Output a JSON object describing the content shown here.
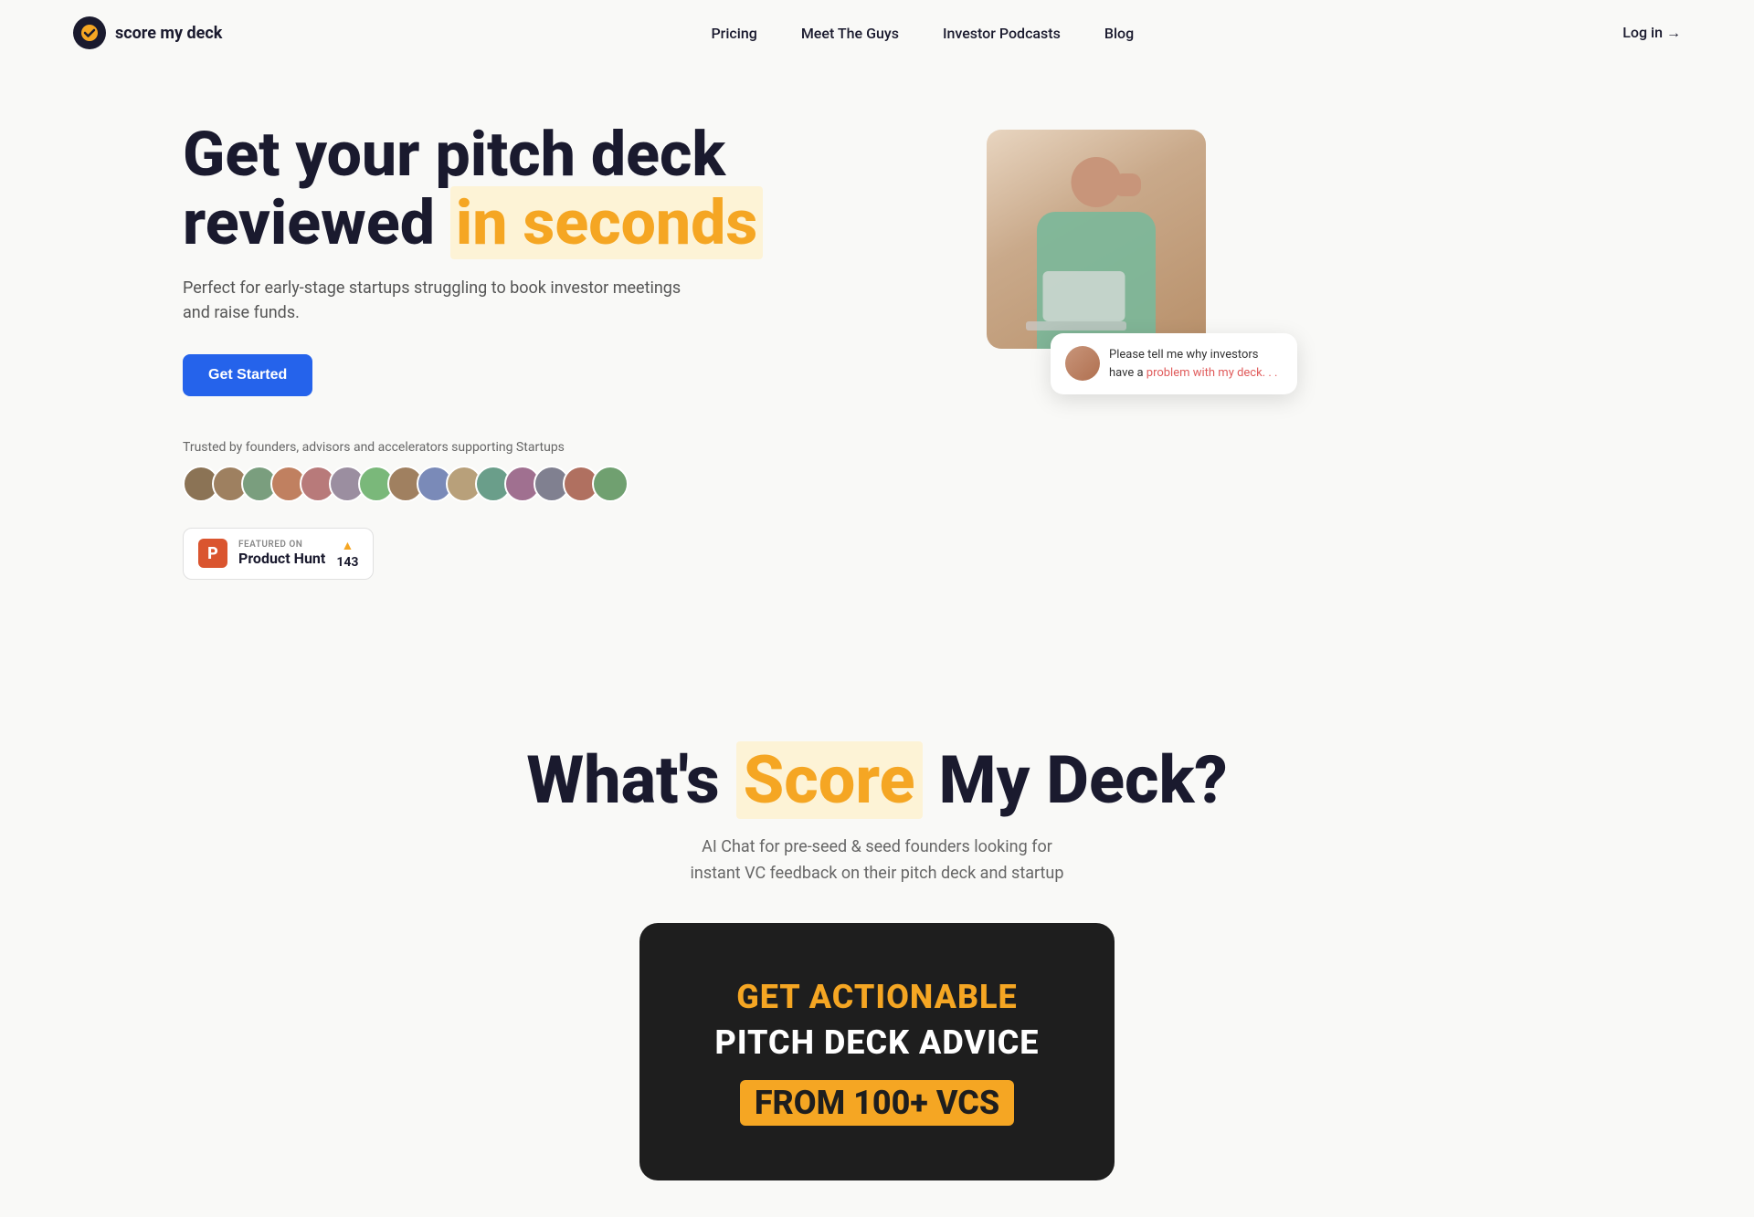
{
  "brand": {
    "name": "score my deck",
    "logo_check": "✓"
  },
  "nav": {
    "links": [
      {
        "label": "Pricing",
        "href": "#"
      },
      {
        "label": "Meet The Guys",
        "href": "#"
      },
      {
        "label": "Investor Podcasts",
        "href": "#"
      },
      {
        "label": "Blog",
        "href": "#"
      }
    ],
    "login_label": "Log in →"
  },
  "hero": {
    "title_line1": "Get your pitch deck",
    "title_line2_plain": "reviewed ",
    "title_line2_highlight": "in seconds",
    "subtitle": "Perfect for early-stage startups struggling to book investor meetings and raise funds.",
    "cta_button": "Get Started",
    "trusted_text": "Trusted by founders, advisors and accelerators supporting Startups",
    "avatars": [
      {
        "id": 1,
        "color": "#8b7355"
      },
      {
        "id": 2,
        "color": "#9e8060"
      },
      {
        "id": 3,
        "color": "#7a9e7e"
      },
      {
        "id": 4,
        "color": "#6b8fa8"
      },
      {
        "id": 5,
        "color": "#b87a7a"
      },
      {
        "id": 6,
        "color": "#9b8ea0"
      },
      {
        "id": 7,
        "color": "#7ab87a"
      },
      {
        "id": 8,
        "color": "#a08060"
      },
      {
        "id": 9,
        "color": "#7a8ab8"
      },
      {
        "id": 10,
        "color": "#b8a07a"
      },
      {
        "id": 11,
        "color": "#6a9e8a"
      },
      {
        "id": 12,
        "color": "#a07090"
      },
      {
        "id": 13,
        "color": "#808090"
      },
      {
        "id": 14,
        "color": "#b07060"
      },
      {
        "id": 15,
        "color": "#70a070"
      }
    ],
    "ph_featured": "FEATURED ON",
    "ph_name": "Product Hunt",
    "ph_count": "143",
    "chat_text_plain": "Please tell me why investors have a ",
    "chat_text_highlight": "problem with my deck. . .",
    "image_placeholder": "woman stressed at laptop"
  },
  "section2": {
    "title_plain1": "What's ",
    "title_highlight": "Score",
    "title_plain2": " My Deck?",
    "subtitle_line1": "AI Chat for pre-seed & seed founders looking for",
    "subtitle_line2": "instant VC feedback on their pitch deck and startup",
    "card_line1": "GET ACTIONABLE",
    "card_line2": "PITCH DECK ADVICE",
    "card_line3": "FROM 100+ VCs"
  }
}
